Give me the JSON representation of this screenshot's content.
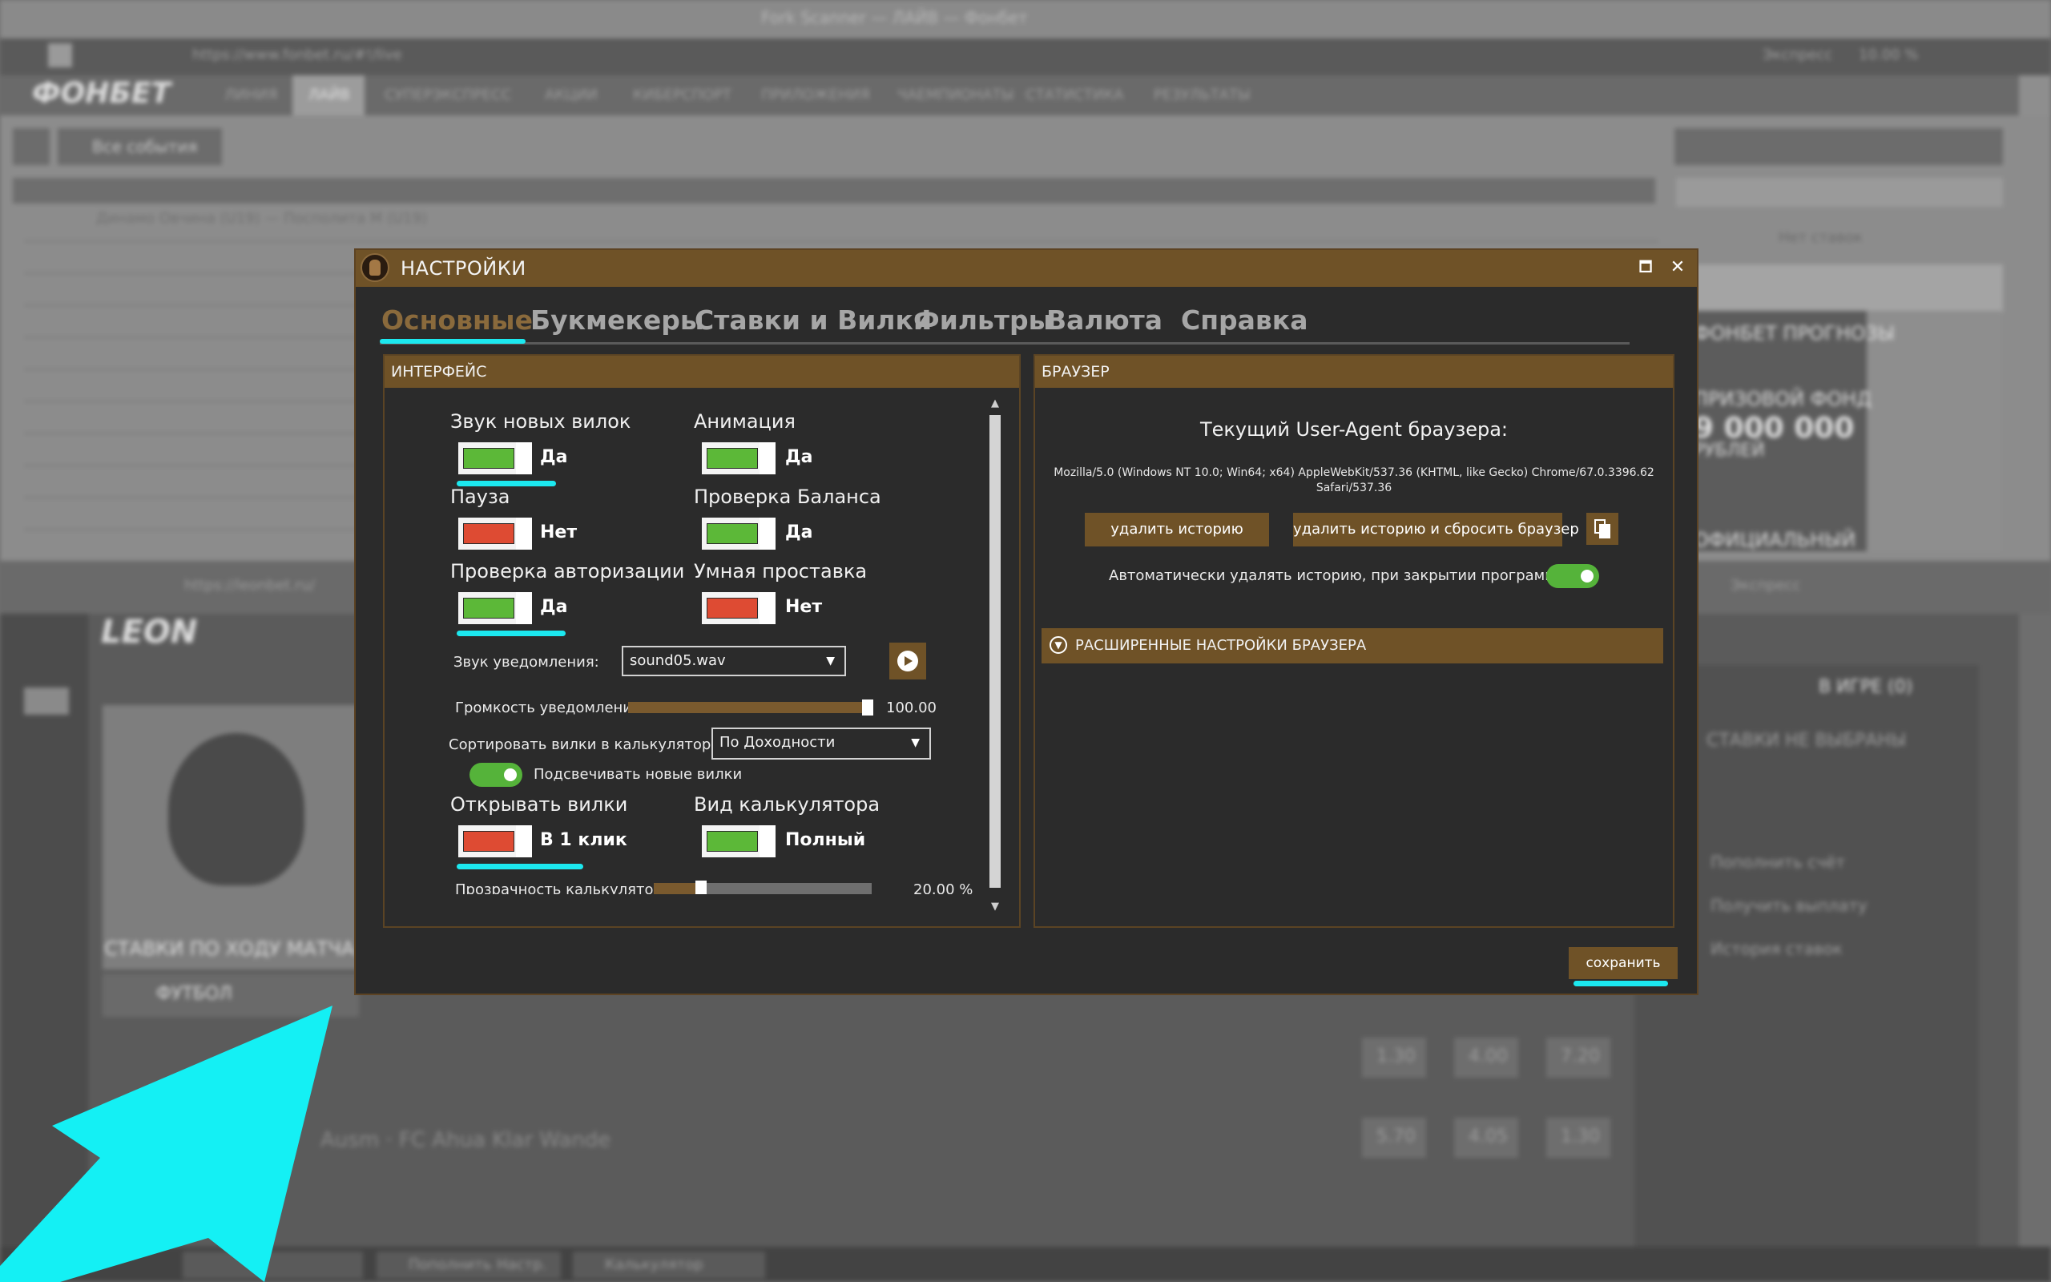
{
  "background": {
    "top_window_title": "Fork Scanner — ЛАЙВ — Фонбет",
    "url_top": "https://www.fonbet.ru/#!/live",
    "search_hint": "Экспресс",
    "zoom": "10.00 %",
    "fonbet_logo": "ФОНБЕТ",
    "fonbet_nav": [
      "ЛИНИЯ",
      "ЛАЙВ",
      "СУПЕРЭКСПРЕСС",
      "АКЦИИ",
      "КИБЕРСПОРТ",
      "ПРИЛОЖЕНИЯ",
      "ЧАЕМПИОНАТЫ",
      "СТАТИСТИКА",
      "РЕЗУЛЬТАТЫ"
    ],
    "all_events": "Все события",
    "no_bets": "Нет ставок",
    "match_row": "Динамо Овчина (U19) — Посполита M (U19)",
    "leon_logo": "LEON",
    "leon_url": "https://leonbet.ru/",
    "leon_header": "СТАВКИ ПО ХОДУ МАТЧА",
    "leon_sport": "ФУТБОЛ",
    "in_game": "В ИГРЕ (0)",
    "not_selected": "СТАВКИ НЕ ВЫБРАНЫ",
    "links": [
      "Пополнить счёт",
      "Получить выплату",
      "История ставок"
    ],
    "bottom_match": "Ausm · FC Ahua Klar Wande",
    "odds": [
      "1.30",
      "4.00",
      "7.20",
      "5.70",
      "4.05",
      "1.30"
    ],
    "taskbar": [
      "Пополнить",
      "Настр.",
      "Калькулятор"
    ],
    "promo": [
      "ФОНБЕТ ПРОГНОЗЫ",
      "ПРИЗОВОЙ ФОНД",
      "9 000 000",
      "РУБЛЕЙ",
      "ОФИЦИАЛЬНЫЙ"
    ]
  },
  "window": {
    "title": "НАСТРОЙКИ",
    "maximize_glyph": "🗖",
    "close_glyph": "✕"
  },
  "tabs": [
    "Основные",
    "Букмекеры",
    "Ставки и Вилки",
    "Фильтры",
    "Валюта",
    "Справка"
  ],
  "interface": {
    "header": "ИНТЕРФЕЙС",
    "new_forks_sound": {
      "label": "Звук новых вилок",
      "value": "Да",
      "on": true
    },
    "animation": {
      "label": "Анимация",
      "value": "Да",
      "on": true
    },
    "pause": {
      "label": "Пауза",
      "value": "Нет",
      "on": false
    },
    "balance_check": {
      "label": "Проверка Баланса",
      "value": "Да",
      "on": true
    },
    "auth_check": {
      "label": "Проверка авторизации",
      "value": "Да",
      "on": true
    },
    "smart_bet": {
      "label": "Умная проставка",
      "value": "Нет",
      "on": false
    },
    "notification_sound": {
      "label": "Звук уведомления:",
      "value": "sound05.wav"
    },
    "notification_volume": {
      "label": "Громкость уведомления:",
      "value": "100.00 %",
      "fraction": 1.0
    },
    "sort_forks": {
      "label": "Сортировать вилки в калькуляторе:",
      "value": "По Доходности"
    },
    "highlight_new": {
      "label": "Подсвечивать новые вилки",
      "on": true
    },
    "open_forks": {
      "label": "Открывать вилки",
      "value": "В 1 клик",
      "on": false
    },
    "calc_view": {
      "label": "Вид калькулятора",
      "value": "Полный",
      "on": true
    },
    "calc_transparency": {
      "label": "Прозрачность калькулятора:",
      "value": "20.00 %",
      "fraction": 0.2
    }
  },
  "browser": {
    "header": "БРАУЗЕР",
    "ua_title": "Текущий User-Agent браузера:",
    "ua_line1": "Mozilla/5.0 (Windows NT 10.0; Win64; x64) AppleWebKit/537.36 (KHTML, like Gecko) Chrome/67.0.3396.62",
    "ua_line2": "Safari/537.36",
    "clear_history": "удалить историю",
    "clear_and_reset": "удалить историю и сбросить браузер",
    "auto_clear": {
      "label": "Автоматически удалять историю, при закрытии программы",
      "on": true
    },
    "advanced": "РАСШИРЕННЫЕ НАСТРОЙКИ БРАУЗЕРА"
  },
  "save": "сохранить",
  "colors": {
    "accent_brown": "#6f5227",
    "active_tab": "#8a6a3c",
    "switch_on": "#5cb838",
    "switch_off": "#de4b33",
    "highlight_cyan": "#1ce8ef",
    "window_bg": "#2b2b2b"
  },
  "icons": [
    "app-logo-icon",
    "maximize-icon",
    "close-icon",
    "play-icon",
    "copy-icon",
    "chevron-down-icon",
    "dropdown-caret-icon",
    "cyan-arrow-pointer"
  ]
}
